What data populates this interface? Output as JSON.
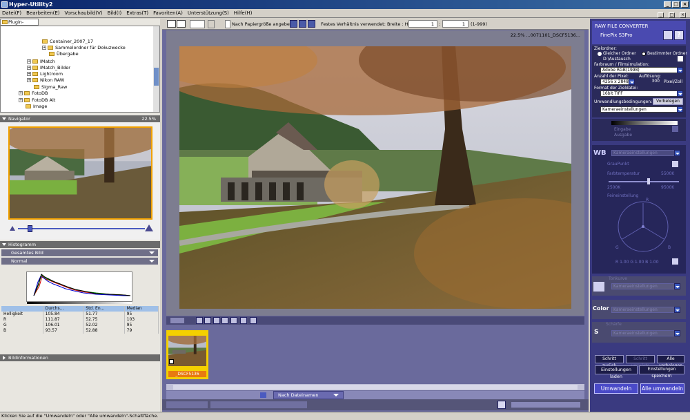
{
  "window": {
    "title": "Hyper-Utility2"
  },
  "menu": [
    "Datei(F)",
    "Bearbeiten(E)",
    "Vorschaubild(V)",
    "Bild(I)",
    "Extras(T)",
    "Favoriten(A)",
    "Unterstützung(S)",
    "Hilfe(H)"
  ],
  "left": {
    "plugin_tab": "Plugin-Ablage",
    "tree": [
      "Container_2007_17",
      "Sammelordner für Dokuzwecke",
      "Übergabe",
      "IMatch",
      "IMatch_Bilder",
      "Lightroom",
      "Nikon RAW",
      "Sigma_Raw",
      "FotoDB",
      "FotoDB Alt",
      "Image"
    ],
    "navigator": {
      "title": "Navigator",
      "zoom": "22.5%"
    },
    "histogram": {
      "title": "Histogramm",
      "scope": "Gesamtes Bild",
      "mode": "Normal",
      "columns": [
        "",
        "Durchs...",
        "Std. En...",
        "Median"
      ],
      "rows": [
        [
          "Helligkeit",
          "105.84",
          "51.77",
          "95"
        ],
        [
          "R",
          "111.87",
          "52.75",
          "103"
        ],
        [
          "G",
          "106.01",
          "52.02",
          "95"
        ],
        [
          "B",
          "93.57",
          "52.88",
          "79"
        ]
      ]
    },
    "info_title": "Bildinformationen"
  },
  "center": {
    "toolbar": {
      "paper_label": "Nach Papiergröße angeben",
      "ratio_label": "Festes Verhältnis verwendet: Breite : Höhe",
      "width": "1",
      "height": "1",
      "range": "(1-999)"
    },
    "viewer_label": "22.5%  ...0071101_DSCF5136...",
    "thumb_name": "_DSCF5136",
    "sort_label": "Nach Dateinamen"
  },
  "right": {
    "title": "RAW FILE CONVERTER",
    "model": "FinePix S3Pro",
    "target_label": "Zielordner:",
    "radio_same": "Gleicher Ordner",
    "radio_chosen": "Bestimmter Ordner",
    "path": "D:\\Austausch",
    "colorspace_label": "Farbraum / Filmsimulation:",
    "colorspace": "Adobe RGB(1998)",
    "pixels_label": "Anzahl der Pixel:",
    "resolution_label": "Auflösung:",
    "pixels": "4256 x 2848",
    "resolution": "300",
    "resolution_unit": "Pixel/Zoll",
    "format_label": "Format der Zieldatei:",
    "format": "16bit TIFF",
    "conditions_label": "Umwandlungsbedingungen:",
    "preset_button": "Vorbelegen",
    "conditions": "Kameraeinstellungen",
    "input_label": "Eingabe",
    "output_label": "Ausgabe",
    "wb_title": "WB",
    "wb_value": "Kameraeinstellungen",
    "graypoint": "GrauPunkt",
    "colortemp_label": "Farbtemperatur",
    "colortemp_value": "5500K",
    "temp_min": "2500K",
    "temp_max": "9500K",
    "finetune_label": "Feineinstellung",
    "rgb_readout": "R 1.00  G 1.00  B 1.00",
    "wheel_labels": [
      "R",
      "G",
      "B"
    ],
    "sections": [
      {
        "name": "Tonkurve",
        "value": "Kameraeinstellungen"
      },
      {
        "name": "Color",
        "value": "Kameraeinstellungen"
      },
      {
        "name": "Schärfe",
        "value": "Kameraeinstellungen"
      },
      {
        "name": "S",
        "value": "Kameraeinstellungen"
      }
    ],
    "btn_back": "Schritt zurück",
    "btn_forward": "Schritt vorwärts",
    "btn_all_preset": "Alle vorbelegen",
    "btn_load": "Einstellungen laden",
    "btn_save": "Einstellungen speichern",
    "btn_convert": "Umwandeln",
    "btn_convert_all": "Alle umwandeln"
  },
  "status": "Klicken Sie auf die \"Umwandeln\" oder \"Alle umwandeln\"-Schaltfläche."
}
